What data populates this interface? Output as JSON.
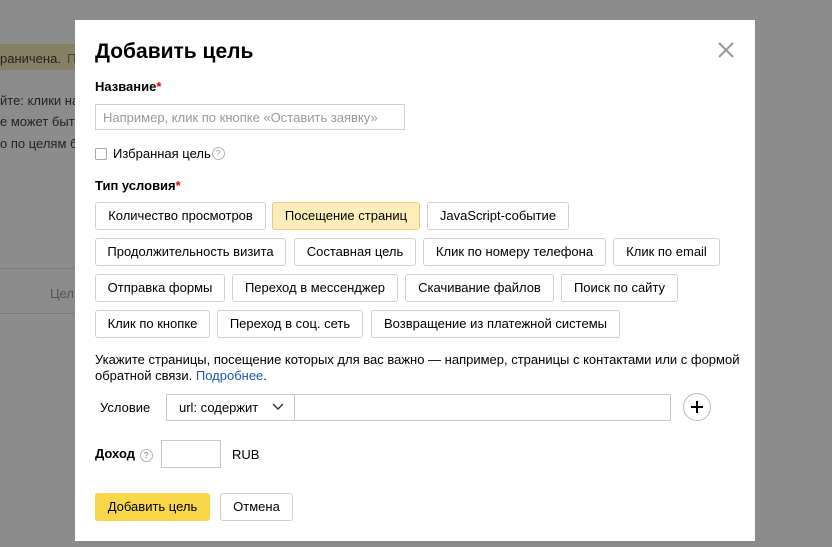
{
  "background": {
    "fragments": [
      "раничена.",
      "П",
      "йте: клики на",
      "е может быть",
      "о по целям б",
      "Цел"
    ]
  },
  "modal": {
    "title": "Добавить цель",
    "name_label": "Название",
    "required_mark": "*",
    "name_placeholder": "Например, клик по кнопке «Оставить заявку»",
    "favorite_label": "Избранная цель",
    "help_glyph": "?",
    "condition_type_label": "Тип условия",
    "condition_types": [
      {
        "label": "Количество просмотров",
        "selected": false
      },
      {
        "label": "Посещение страниц",
        "selected": true
      },
      {
        "label": "JavaScript-событие",
        "selected": false
      },
      {
        "label": "Продолжительность визита",
        "selected": false
      },
      {
        "label": "Составная цель",
        "selected": false
      },
      {
        "label": "Клик по номеру телефона",
        "selected": false
      },
      {
        "label": "Клик по email",
        "selected": false
      },
      {
        "label": "Отправка формы",
        "selected": false
      },
      {
        "label": "Переход в мессенджер",
        "selected": false
      },
      {
        "label": "Скачивание файлов",
        "selected": false
      },
      {
        "label": "Поиск по сайту",
        "selected": false
      },
      {
        "label": "Клик по кнопке",
        "selected": false
      },
      {
        "label": "Переход в соц. сеть",
        "selected": false
      },
      {
        "label": "Возвращение из платежной системы",
        "selected": false
      }
    ],
    "description": "Укажите страницы, посещение которых для вас важно — например, страницы с контактами или с формой обратной связи.",
    "description_link": "Подробнее",
    "description_end": ".",
    "condition_label": "Условие",
    "condition_select_value": "url: содержит",
    "condition_value": "",
    "income_label": "Доход",
    "income_value": "",
    "currency": "RUB",
    "submit_label": "Добавить цель",
    "cancel_label": "Отмена"
  },
  "colors": {
    "selected_chip": "#fceeb8",
    "primary_button": "#f8d74a",
    "link": "#1a5bb5",
    "required": "#e60000"
  },
  "icons": [
    "close-icon",
    "help-icon",
    "chevron-down-icon",
    "plus-icon",
    "checkbox"
  ]
}
